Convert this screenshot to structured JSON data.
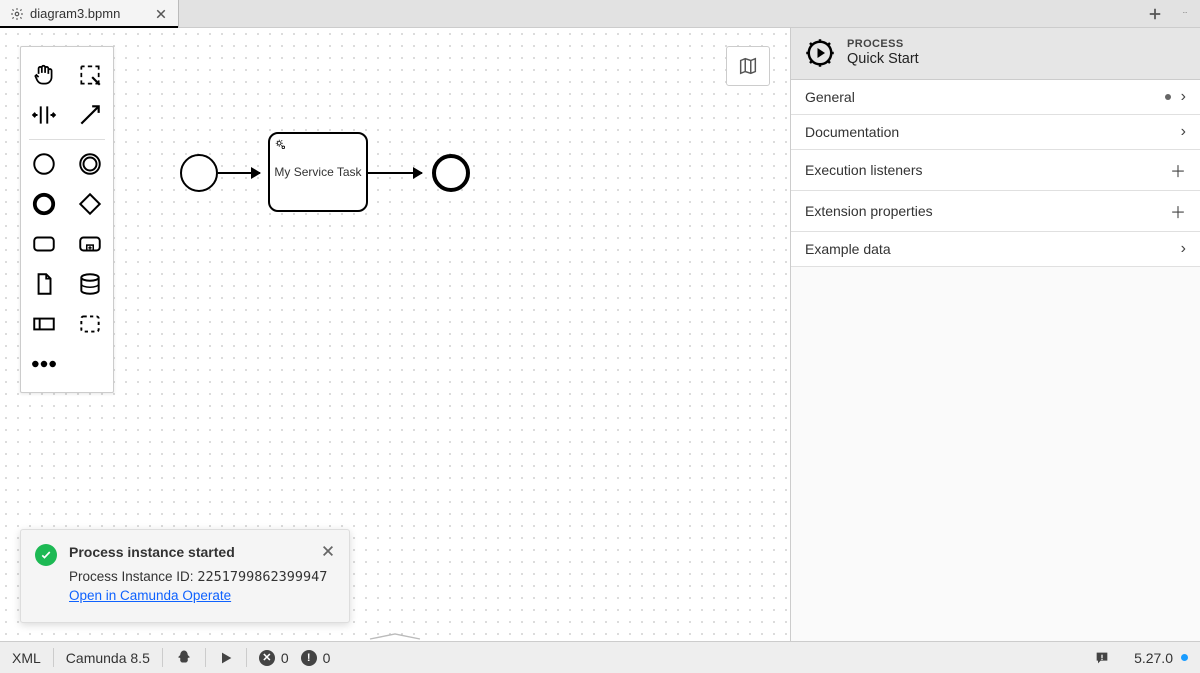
{
  "tab": {
    "label": "diagram3.bpmn"
  },
  "canvas": {
    "task_label": "My Service Task"
  },
  "toast": {
    "title": "Process instance started",
    "id_label": "Process Instance ID:",
    "id_value": "2251799862399947",
    "link": "Open in Camunda Operate"
  },
  "properties": {
    "eyebrow": "PROCESS",
    "title": "Quick Start",
    "groups": [
      {
        "label": "General",
        "indicator": "dot",
        "action": "chevron"
      },
      {
        "label": "Documentation",
        "indicator": null,
        "action": "chevron"
      },
      {
        "label": "Execution listeners",
        "indicator": null,
        "action": "plus"
      },
      {
        "label": "Extension properties",
        "indicator": null,
        "action": "plus"
      },
      {
        "label": "Example data",
        "indicator": null,
        "action": "chevron"
      }
    ]
  },
  "status": {
    "xml": "XML",
    "platform": "Camunda 8.5",
    "errors": "0",
    "warnings": "0",
    "version": "5.27.0"
  }
}
